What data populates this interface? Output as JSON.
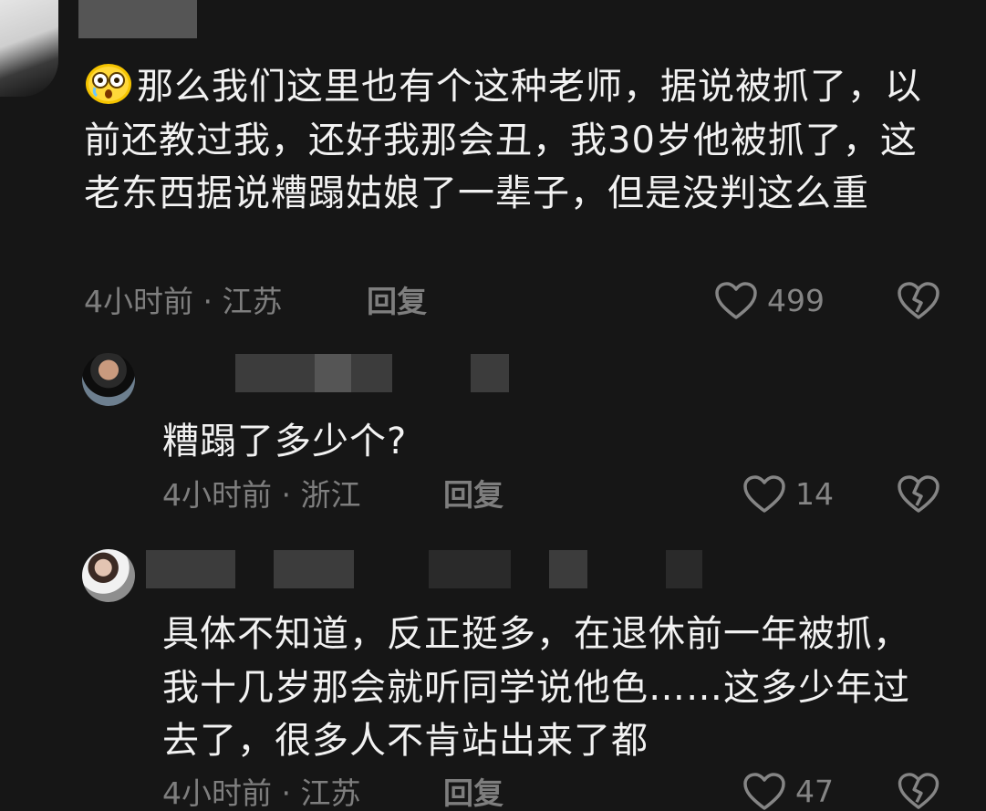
{
  "comments": [
    {
      "text": "那么我们这里也有个这种老师，据说被抓了，以前还教过我，还好我那会丑，我30岁他被抓了，这老东西据说糟蹋姑娘了一辈子，但是没判这么重",
      "meta": "4小时前 · 江苏",
      "reply_label": "回复",
      "likes": "499",
      "emoji": "shocked-emoji"
    },
    {
      "text": "糟蹋了多少个?",
      "meta": "4小时前 · 浙江",
      "reply_label": "回复",
      "likes": "14"
    },
    {
      "text": "具体不知道，反正挺多，在退休前一年被抓，我十几岁那会就听同学说他色……这多少年过去了，很多人不肯站出来了都",
      "meta": "4小时前 · 江苏",
      "reply_label": "回复",
      "likes": "47"
    }
  ],
  "icons": {
    "like": "heart-outline-icon",
    "dislike": "broken-heart-icon"
  },
  "colors": {
    "background": "#161616",
    "text": "#f2f2f2",
    "meta": "#7e7e7e"
  }
}
